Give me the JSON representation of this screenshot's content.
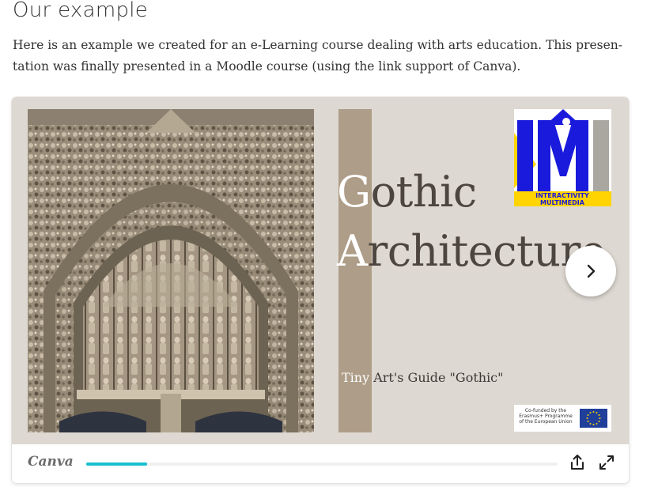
{
  "heading": "Our example",
  "intro": "Here is an example we created for an e-Learning course dealing with arts education. This presen-tation was finally presented in a Moodle course (using the link support of Canva).",
  "slide": {
    "title_line1_cap": "G",
    "title_line1_rest": "othic",
    "title_line2_cap": "A",
    "title_line2_rest": "rchitecture",
    "subtitle_cap": "Tiny",
    "subtitle_rest": " Art's Guide \"Gothic\"",
    "logo_im_text": "IM",
    "logo_im_caption_line1": "INTERACTIVITY",
    "logo_im_caption_line2": "MULTIMEDIA",
    "eu_text_line1": "Co-funded by the",
    "eu_text_line2": "Erasmus+ Programme",
    "eu_text_line3": "of the European Union"
  },
  "footer": {
    "brand": "Canva",
    "progress": 0.13,
    "icons": [
      "share-icon",
      "fullscreen-icon"
    ]
  },
  "colors": {
    "slide_bg": "#ddd8d1",
    "accent_bar": "#ae9d88",
    "progress": "#18bfcf",
    "im_blue": "#1a1adc",
    "im_yellow": "#ffd400"
  }
}
